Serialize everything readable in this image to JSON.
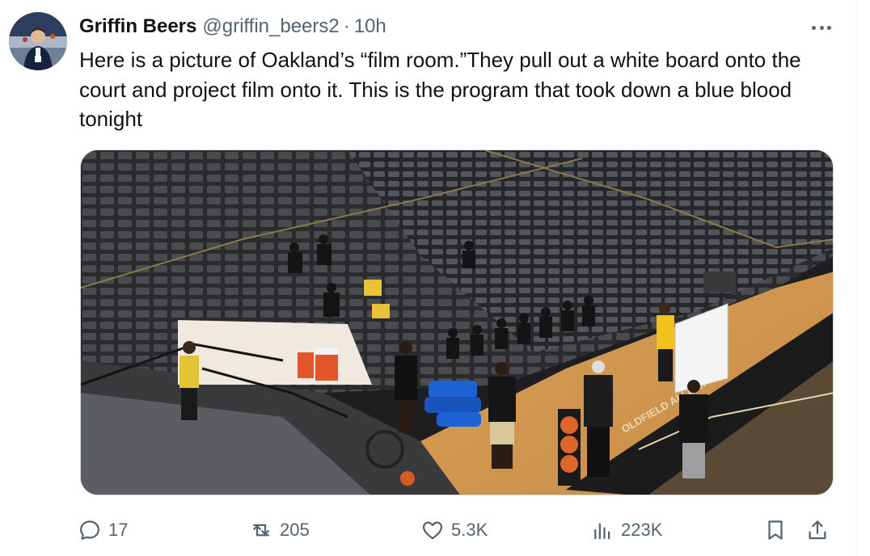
{
  "tweet": {
    "author_name": "Griffin Beers",
    "handle": "@griffin_beers2",
    "separator": "·",
    "time": "10h",
    "text": "Here is a picture of Oakland’s “film room.”They pull out a white board onto the court and project film onto it. This is the program that took down a blue blood tonight",
    "media_court_text": "OLDFIELD ALLIES.COM",
    "avatar_icon": "profile-photo",
    "more_icon": "more-dots-icon"
  },
  "actions": {
    "reply_count": "17",
    "retweet_count": "205",
    "like_count": "5.3K",
    "view_count": "223K",
    "reply_icon": "reply-icon",
    "retweet_icon": "retweet-icon",
    "like_icon": "heart-icon",
    "views_icon": "views-icon",
    "bookmark_icon": "bookmark-icon",
    "share_icon": "share-icon"
  },
  "colors": {
    "text_primary": "#0f1419",
    "text_secondary": "#536471",
    "border": "#cfd9de"
  }
}
